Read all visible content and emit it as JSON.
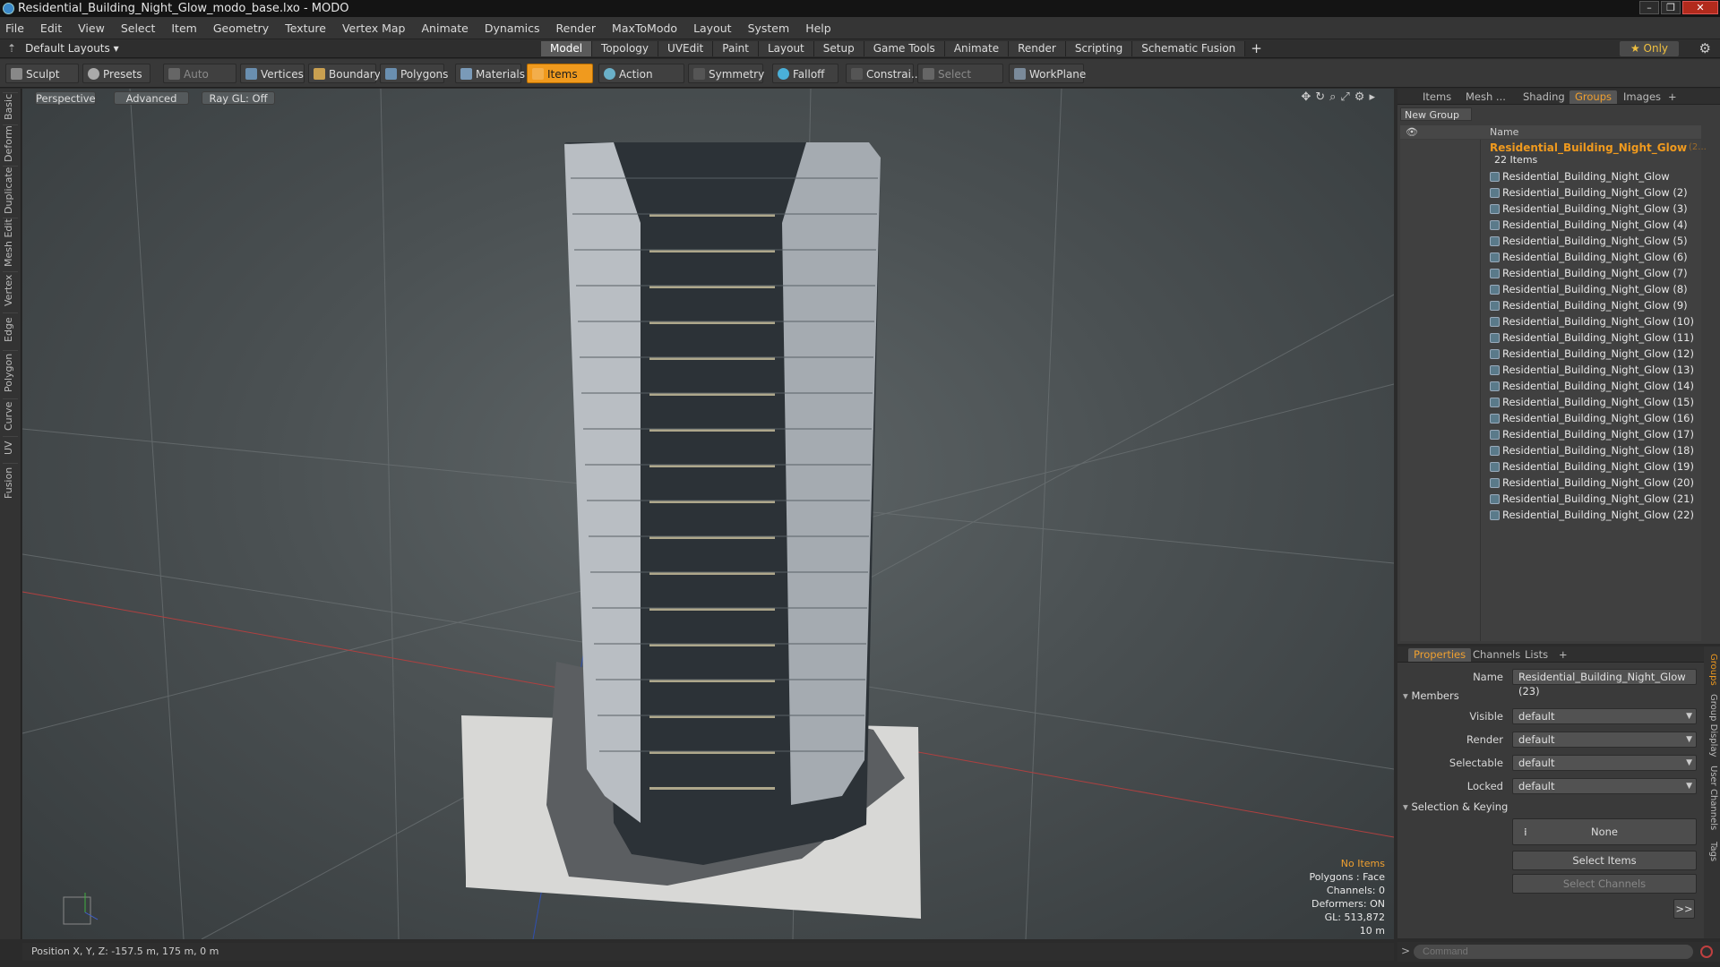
{
  "window": {
    "title": "Residential_Building_Night_Glow_modo_base.lxo - MODO",
    "controls": [
      "–",
      "❐",
      "✕"
    ]
  },
  "menu": [
    "File",
    "Edit",
    "View",
    "Select",
    "Item",
    "Geometry",
    "Texture",
    "Vertex Map",
    "Animate",
    "Dynamics",
    "Render",
    "MaxToModo",
    "Layout",
    "System",
    "Help"
  ],
  "layout": {
    "default_layouts": "Default Layouts",
    "tabs": [
      "Model",
      "Topology",
      "UVEdit",
      "Paint",
      "Layout",
      "Setup",
      "Game Tools",
      "Animate",
      "Render",
      "Scripting",
      "Schematic Fusion"
    ],
    "active_tab": "Model",
    "add": "+",
    "only": "Only"
  },
  "toolbar": {
    "sculpt": "Sculpt",
    "presets": "Presets",
    "auto_select": "Auto Select",
    "vertices": "Vertices",
    "boundary": "Boundary",
    "polygons": "Polygons",
    "materials": "Materials",
    "items": "Items",
    "action_center": "Action Center",
    "symmetry": "Symmetry",
    "falloff": "Falloff",
    "constrain": "Constrai...",
    "select_through": "Select Through",
    "workplane": "WorkPlane"
  },
  "left_tabs": [
    "Basic",
    "Deform",
    "Duplicate",
    "Mesh Edit",
    "Vertex",
    "Edge",
    "Polygon",
    "Curve",
    "UV",
    "Fusion"
  ],
  "viewport": {
    "perspective": "Perspective",
    "advanced": "Advanced",
    "raygl": "Ray GL: Off",
    "stats": {
      "no_items": "No Items",
      "polygons": "Polygons : Face",
      "channels": "Channels: 0",
      "deformers": "Deformers: ON",
      "gl": "GL: 513,872",
      "scale": "10 m"
    }
  },
  "status": {
    "position": "Position X, Y, Z:  -157.5 m, 175 m, 0 m"
  },
  "groups_panel": {
    "tabs": [
      "Items",
      "Mesh ...",
      "Shading",
      "Groups",
      "Images",
      "+"
    ],
    "active_tab": "Groups",
    "new_group": "New Group",
    "col_name": "Name",
    "group_name": "Residential_Building_Night_Glow",
    "group_suffix": "(2...",
    "group_count": "22 Items",
    "items": [
      "Residential_Building_Night_Glow",
      "Residential_Building_Night_Glow (2)",
      "Residential_Building_Night_Glow (3)",
      "Residential_Building_Night_Glow (4)",
      "Residential_Building_Night_Glow (5)",
      "Residential_Building_Night_Glow (6)",
      "Residential_Building_Night_Glow (7)",
      "Residential_Building_Night_Glow (8)",
      "Residential_Building_Night_Glow (9)",
      "Residential_Building_Night_Glow (10)",
      "Residential_Building_Night_Glow (11)",
      "Residential_Building_Night_Glow (12)",
      "Residential_Building_Night_Glow (13)",
      "Residential_Building_Night_Glow (14)",
      "Residential_Building_Night_Glow (15)",
      "Residential_Building_Night_Glow (16)",
      "Residential_Building_Night_Glow (17)",
      "Residential_Building_Night_Glow (18)",
      "Residential_Building_Night_Glow (19)",
      "Residential_Building_Night_Glow (20)",
      "Residential_Building_Night_Glow (21)",
      "Residential_Building_Night_Glow (22)"
    ]
  },
  "properties": {
    "tabs": [
      "Properties",
      "Channels",
      "Lists",
      "+"
    ],
    "name_label": "Name",
    "name_value": "Residential_Building_Night_Glow (23)",
    "members": "Members",
    "visible_label": "Visible",
    "visible": "default",
    "render_label": "Render",
    "render": "default",
    "selectable_label": "Selectable",
    "selectable": "default",
    "locked_label": "Locked",
    "locked": "default",
    "sel_keying": "Selection & Keying",
    "none": "None",
    "select_items": "Select Items",
    "select_channels": "Select Channels",
    "expand": ">>",
    "side_tabs": [
      "Groups",
      "Group Display",
      "User Channels",
      "Tags"
    ]
  },
  "command": {
    "placeholder": "Command",
    "prompt": ">"
  }
}
